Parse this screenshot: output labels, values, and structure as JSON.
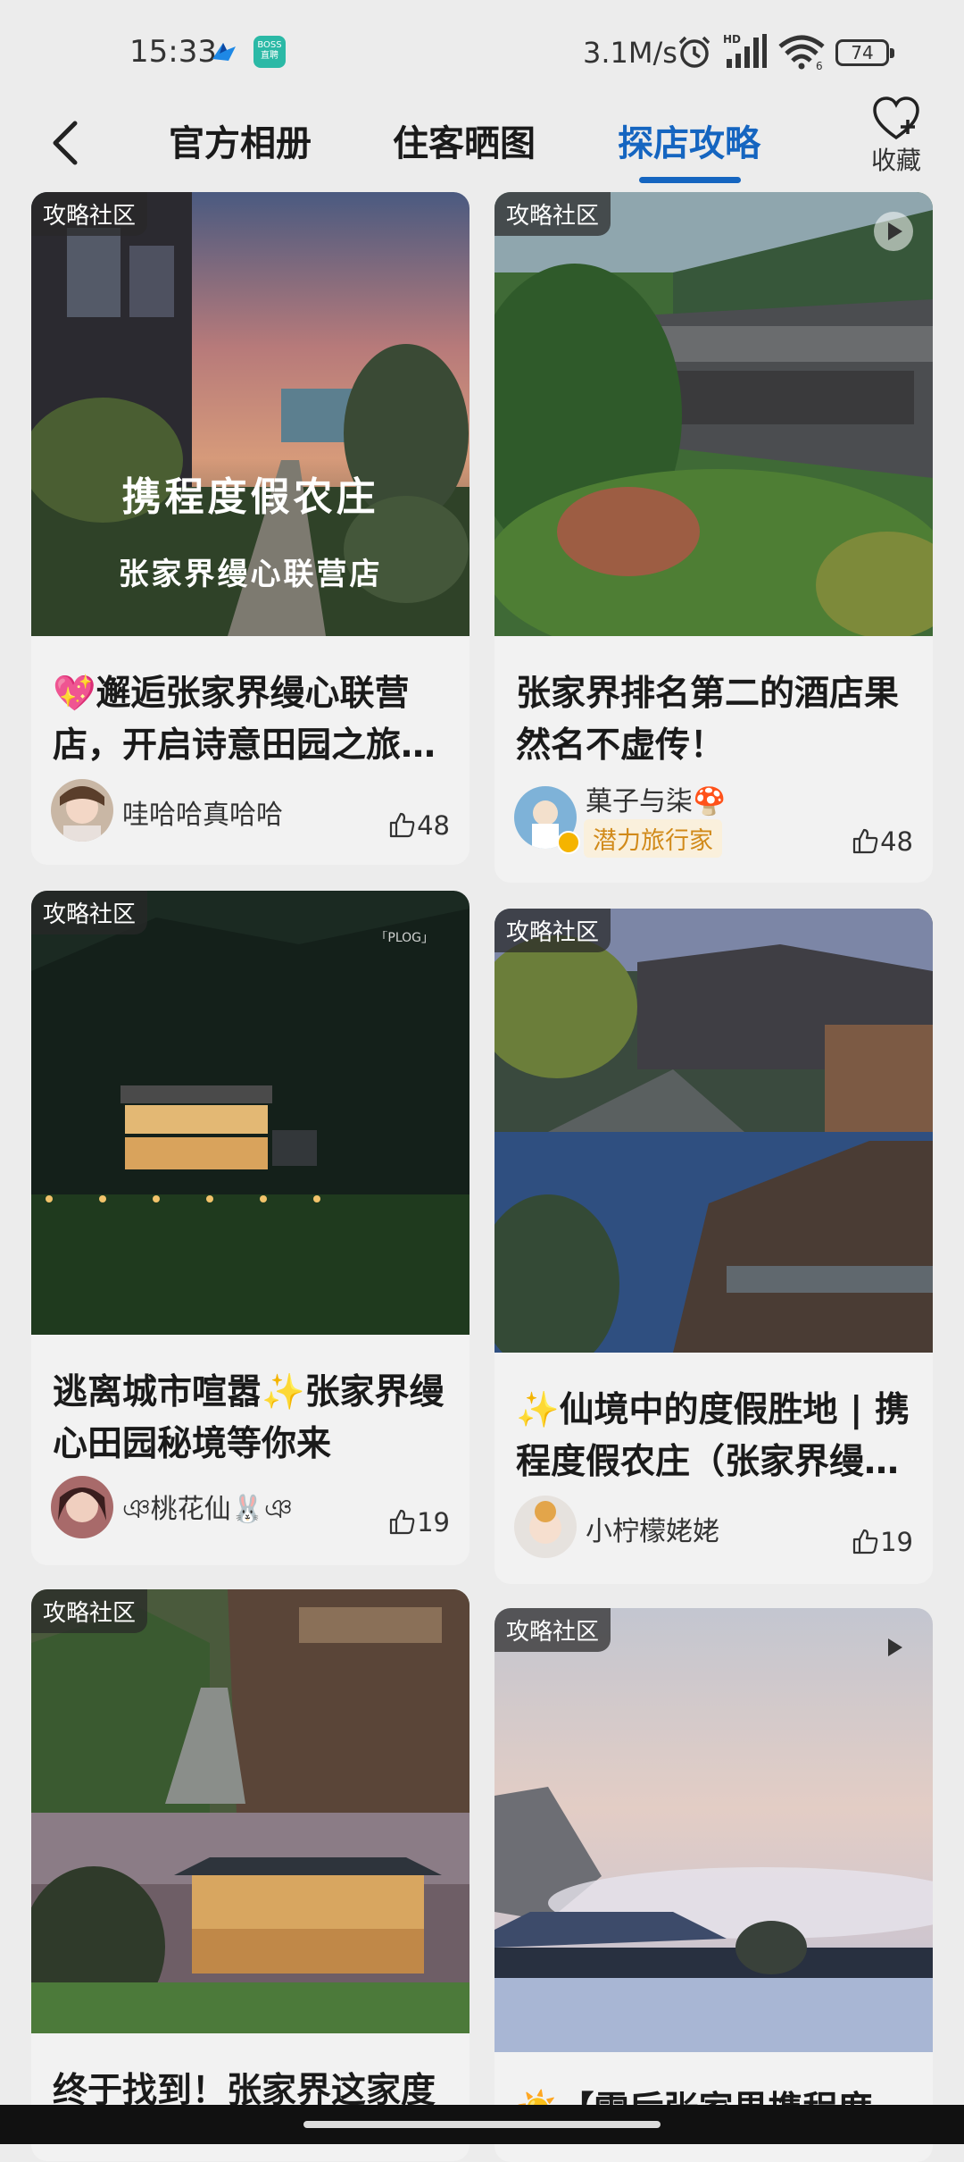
{
  "status_bar": {
    "time": "15:33",
    "boss_icon_text": "BOSS\n直聘",
    "network_speed": "3.1M/s",
    "battery": "74"
  },
  "header": {
    "tabs": [
      {
        "label": "官方相册",
        "active": false
      },
      {
        "label": "住客晒图",
        "active": false
      },
      {
        "label": "探店攻略",
        "active": true
      }
    ],
    "favorite_label": "收藏",
    "accent_color": "#1565c0"
  },
  "cards": [
    {
      "badge": "攻略社区",
      "image_caption_line1": "携程度假农庄",
      "image_caption_line2": "张家界缦心联营店",
      "title": "💖邂逅张家界缦心联营店，开启诗意田园之旅…",
      "author": "哇哈哈真哈哈",
      "likes": "48"
    },
    {
      "badge": "攻略社区",
      "title": "张家界排名第二的酒店果然名不虚传！",
      "author": "菓子与柒🍄",
      "author_tag": "潜力旅行家",
      "likes": "48",
      "has_video": true
    },
    {
      "badge": "攻略社区",
      "image_caption": "「PLOG」",
      "title": "逃离城市喧嚣✨张家界缦心田园秘境等你来",
      "author": "ঞ桃花仙🐰ঞ",
      "likes": "19"
    },
    {
      "badge": "攻略社区",
      "title": "✨仙境中的度假胜地 | 携程度假农庄（张家界缦…",
      "author": "小柠檬姥姥",
      "likes": "19"
    },
    {
      "badge": "攻略社区",
      "title": "终于找到！张家界这家度",
      "author": "",
      "likes": ""
    },
    {
      "badge": "攻略社区",
      "title": "☀️【雪后张家界携程度",
      "author": "",
      "likes": "",
      "has_video": true
    }
  ]
}
